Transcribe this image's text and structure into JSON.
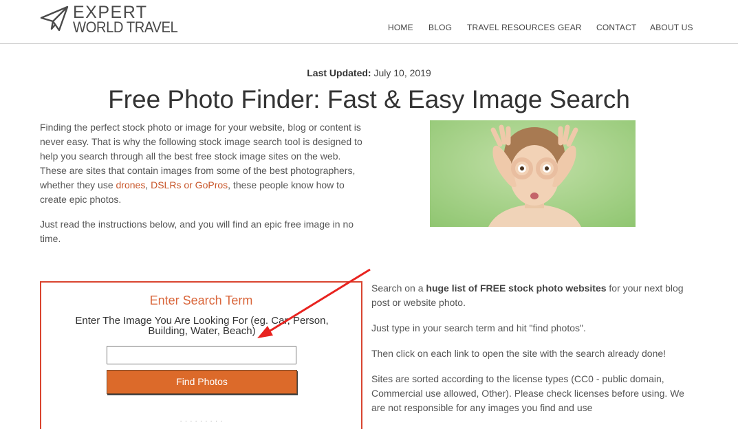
{
  "header": {
    "logo": {
      "line1": "EXPERT",
      "line2": "WORLD TRAVEL",
      "icon": "paper-plane-icon"
    },
    "nav": [
      {
        "label": "HOME"
      },
      {
        "label": "BLOG"
      },
      {
        "label": "TRAVEL RESOURCES"
      },
      {
        "label": "GEAR"
      },
      {
        "label": "CONTACT"
      },
      {
        "label": "ABOUT US"
      }
    ]
  },
  "meta": {
    "updated_label": "Last Updated:",
    "updated_date": "July 10, 2019"
  },
  "page": {
    "title": "Free Photo Finder: Fast & Easy Image Search"
  },
  "intro": {
    "p1_a": "Finding the perfect stock photo or image  for your website, blog or content is never easy. That is why the following stock image search tool is designed to help you search through all the best free stock image sites on the web. These are sites that contain images from some of the best photographers, whether they use ",
    "link_drones": "drones",
    "comma": ", ",
    "link_dslr": "DSLRs or GoPros",
    "p1_b": ", these people know how to create epic photos.",
    "p2": "Just read the instructions below, and you will find an epic free image in no time."
  },
  "search": {
    "heading": "Enter Search Term",
    "instructions": "Enter The Image You Are Looking For (eg. Car, Person, Building, Water, Beach)",
    "input_value": "",
    "input_placeholder": "",
    "button_label": "Find Photos"
  },
  "side": {
    "p1_pre": "Search on a ",
    "p1_bold": "huge list of FREE stock photo websites",
    "p1_post": " for your next blog post or website photo.",
    "p2": "Just type in your search term and hit \"find photos\".",
    "p3": "Then click on each link to open the site with the search already done!",
    "p4": "Sites are sorted according to the license types (CC0 - public domain, Commercial use allowed, Other). Please check licenses before using. We are not responsible for any images you find and use"
  },
  "colors": {
    "accent": "#dc6a2a",
    "link": "#c8562a",
    "arrow": "#e8231f",
    "box_border": "#d9442f"
  }
}
